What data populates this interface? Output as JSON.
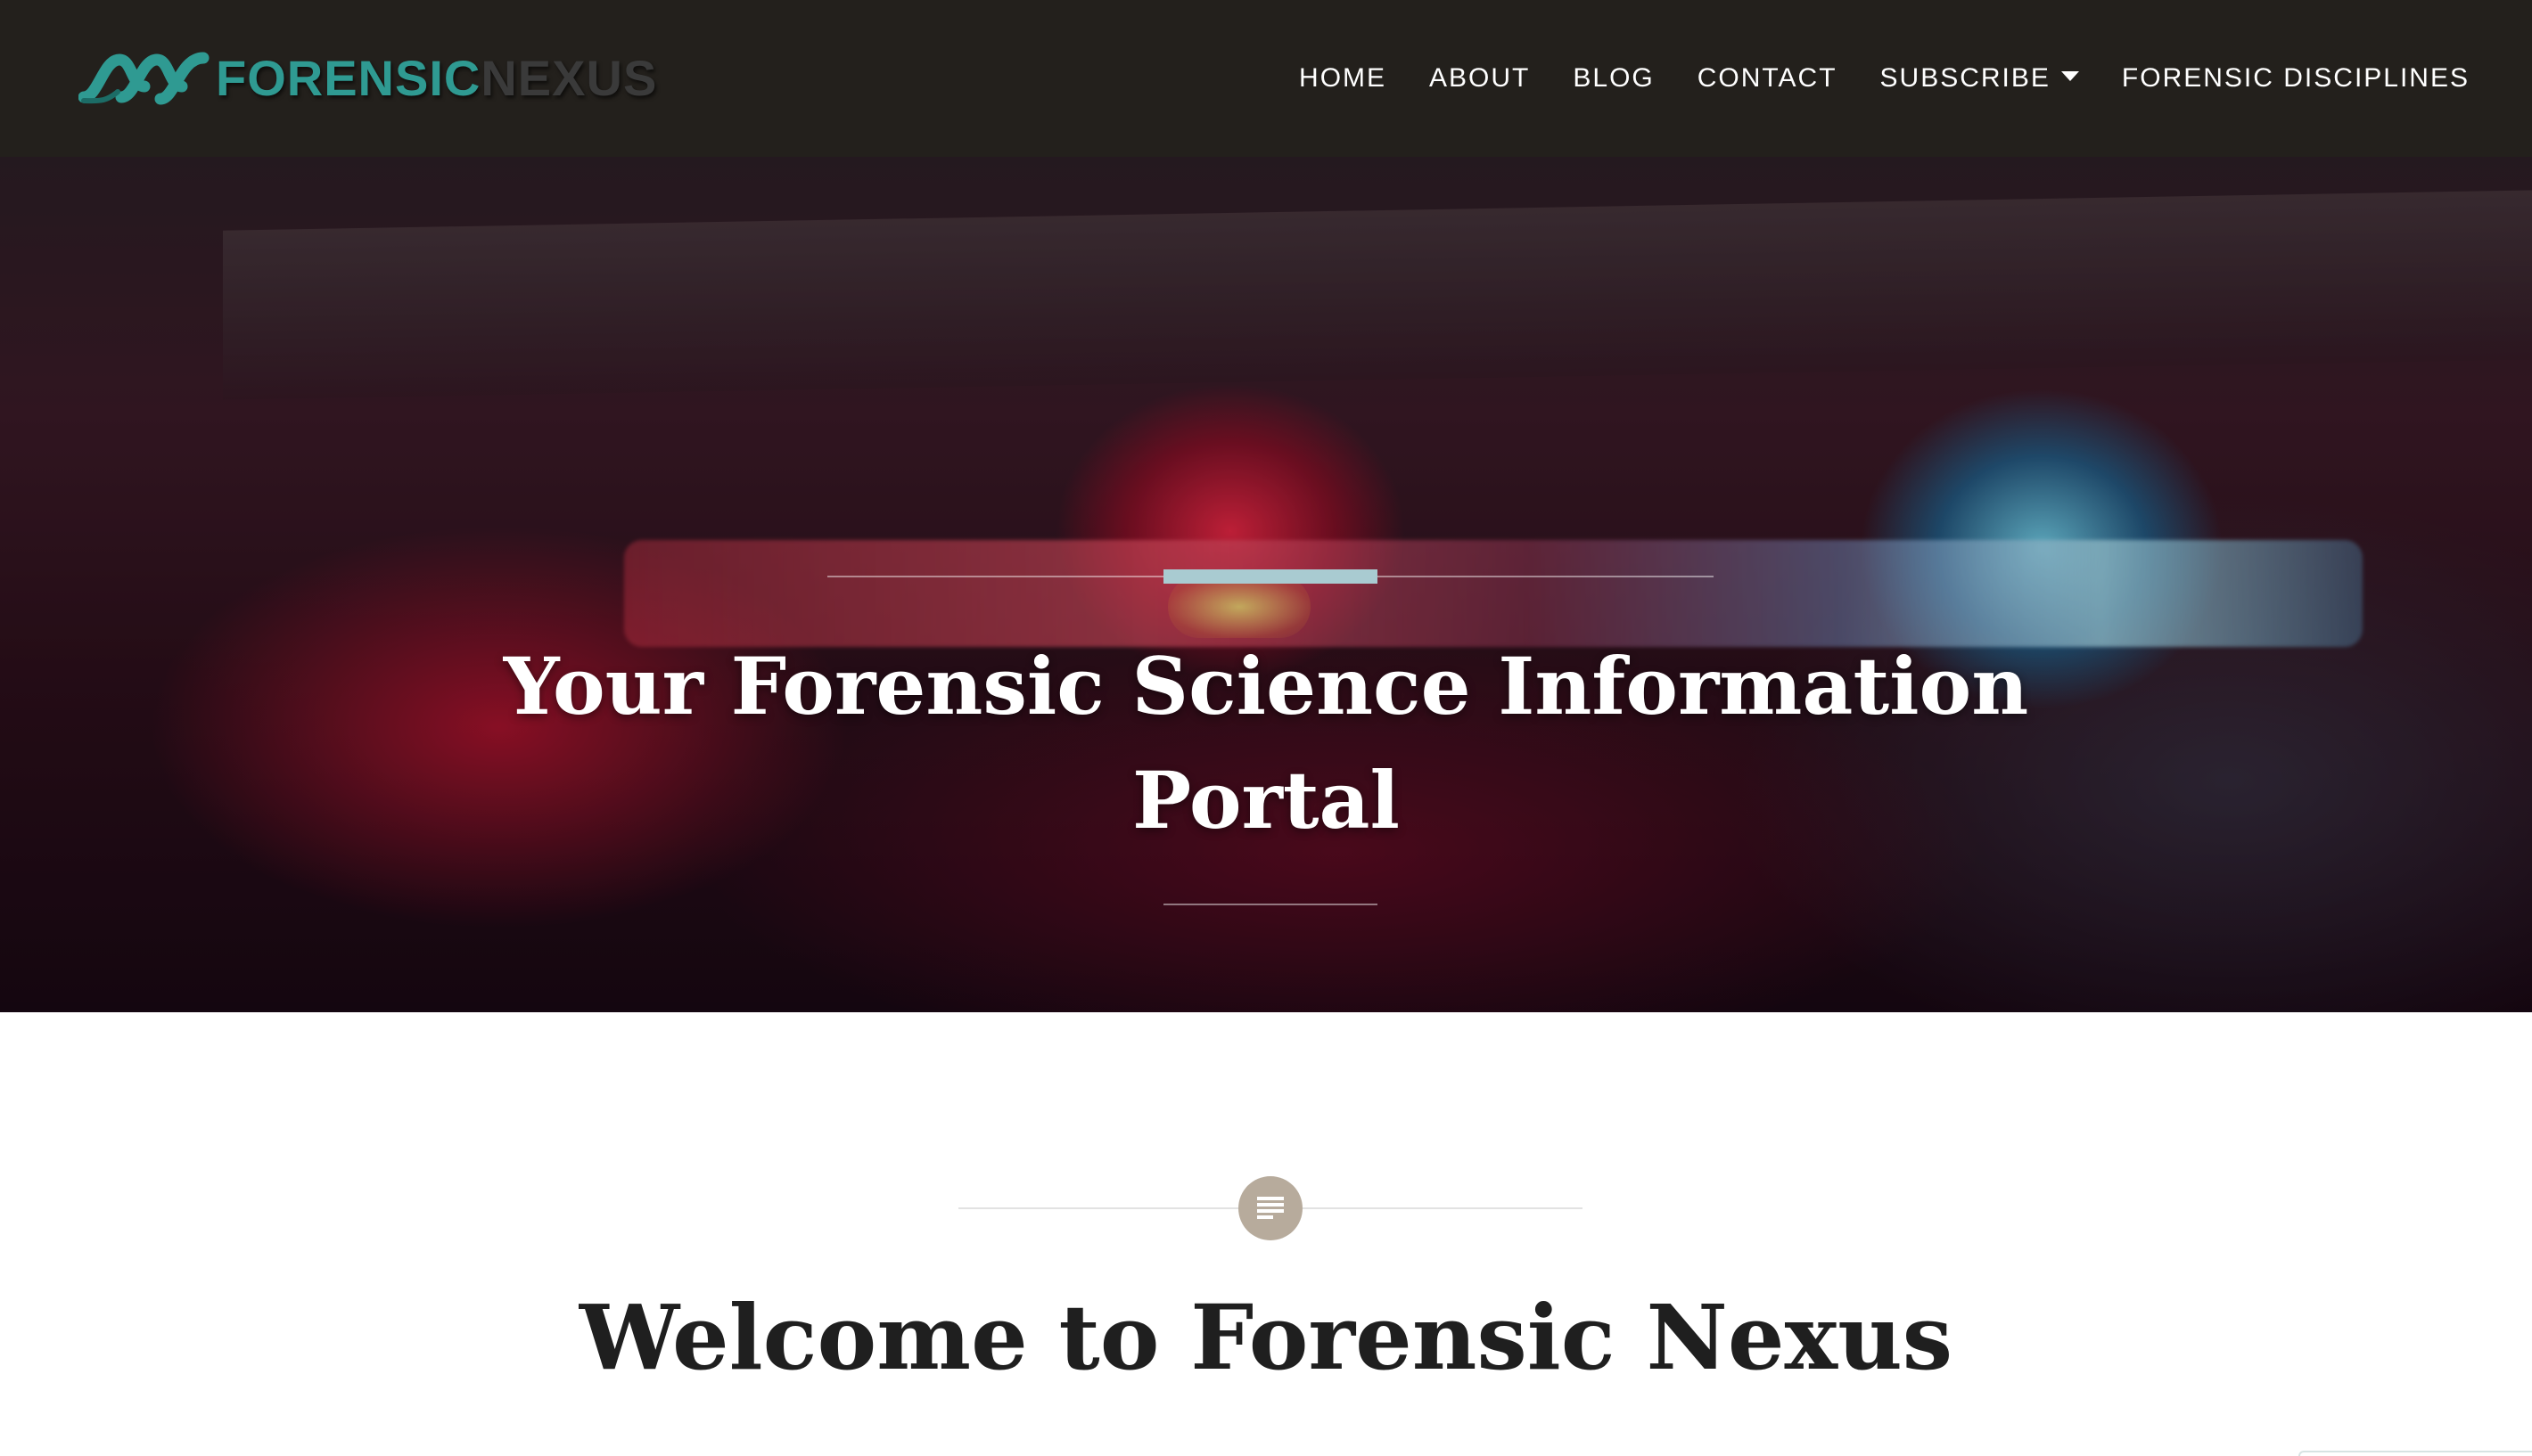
{
  "brand": {
    "name_part1": "FORENSIC",
    "name_part2": "NEXUS",
    "colors": {
      "primary": "#2f9a92",
      "secondary": "#3a3a3a"
    }
  },
  "nav": {
    "items": [
      {
        "label": "HOME"
      },
      {
        "label": "ABOUT"
      },
      {
        "label": "BLOG"
      },
      {
        "label": "CONTACT"
      },
      {
        "label": "SUBSCRIBE",
        "has_dropdown": true
      },
      {
        "label": "FORENSIC DISCIPLINES"
      }
    ],
    "background": "#23201c",
    "text_color": "#ffffff"
  },
  "hero": {
    "title": "Your Forensic Science Information Portal",
    "accent_color": "#a9cbd1"
  },
  "welcome": {
    "icon": "text-lines-icon",
    "icon_bg": "#b7ab9c",
    "title": "Welcome to Forensic Nexus"
  }
}
